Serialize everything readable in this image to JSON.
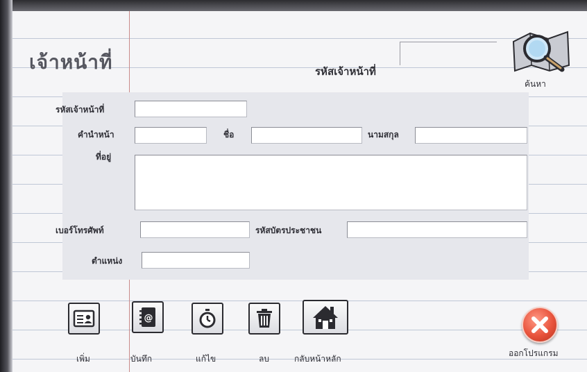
{
  "window": {
    "title": "เจ้าหน้าที่"
  },
  "search": {
    "id_label": "รหัสเจ้าหน้าที่",
    "id_value": "",
    "button_label": "ค้นหา",
    "icon": "magnifier-on-map-icon"
  },
  "form": {
    "staff_id": {
      "label": "รหัสเจ้าหน้าที่",
      "value": ""
    },
    "prefix": {
      "label": "คำนำหน้า",
      "value": ""
    },
    "first_name": {
      "label": "ชื่อ",
      "value": ""
    },
    "last_name": {
      "label": "นามสกุล",
      "value": ""
    },
    "address": {
      "label": "ที่อยู่",
      "value": ""
    },
    "phone": {
      "label": "เบอร์โทรศัพท์",
      "value": ""
    },
    "national_id": {
      "label": "รหัสบัตรประชาชน",
      "value": ""
    },
    "position": {
      "label": "ตำแหน่ง",
      "value": ""
    }
  },
  "toolbar": {
    "add": {
      "label": "เพิ่ม",
      "icon": "contact-card-icon"
    },
    "save": {
      "label": "บันทึก",
      "icon": "address-book-icon"
    },
    "edit": {
      "label": "แก้ไข",
      "icon": "stopwatch-icon"
    },
    "delete": {
      "label": "ลบ",
      "icon": "trash-icon"
    },
    "home": {
      "label": "กลับหน้าหลัก",
      "icon": "home-icon"
    },
    "exit": {
      "label": "ออกโปรแกรม",
      "icon": "close-circle-icon"
    }
  },
  "colors": {
    "panel": "#e6e7ec",
    "exit_red": "#e8533c",
    "rule_line": "#bfc7d6",
    "margin_line": "#c98a8a"
  }
}
